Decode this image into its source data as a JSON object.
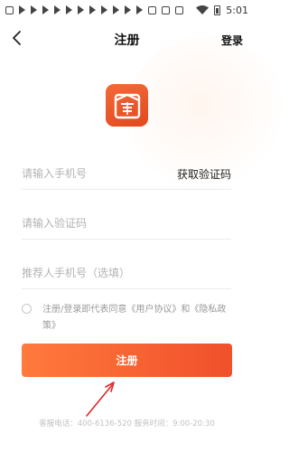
{
  "status_bar": {
    "time": "5:01"
  },
  "nav": {
    "title": "注册",
    "login_label": "登录"
  },
  "form": {
    "phone_placeholder": "请输入手机号",
    "get_code_label": "获取验证码",
    "code_placeholder": "请输入验证码",
    "referrer_placeholder": "推荐人手机号（选填）"
  },
  "agreement": {
    "text": "注册/登录即代表同意《用户协议》和《隐私政策》"
  },
  "register_button": {
    "label": "注册"
  },
  "footer": {
    "service_line": "客服电话：400-6136-520   服务时间：9:00-20:30"
  },
  "colors": {
    "accent": "#f0502a",
    "accent_light": "#ff7a3d"
  },
  "icons": [
    "back-arrow-icon",
    "app-logo-icon",
    "radio-circle-icon",
    "wifi-icon",
    "battery-icon"
  ]
}
